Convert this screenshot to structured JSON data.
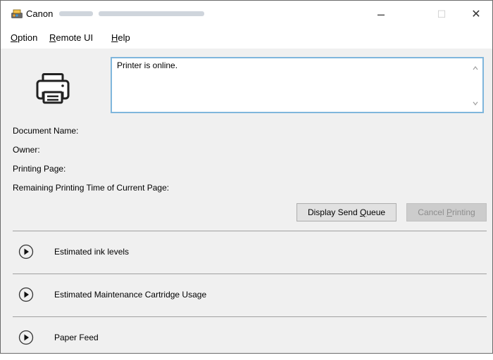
{
  "titlebar": {
    "brand": "Canon",
    "buttons": {
      "minimize": "–",
      "maximize": "☐",
      "close": "✕"
    }
  },
  "menu": [
    {
      "mnemonic": "O",
      "rest": "ption"
    },
    {
      "mnemonic": "R",
      "rest": "emote UI"
    },
    {
      "mnemonic": "H",
      "rest": "elp"
    }
  ],
  "status": {
    "message": "Printer is online."
  },
  "info": {
    "document_name": "Document Name:",
    "owner": "Owner:",
    "printing_page": "Printing Page:",
    "remaining_time": "Remaining Printing Time of Current Page:"
  },
  "buttons": {
    "display_queue": {
      "before": "Display Send ",
      "mnemonic": "Q",
      "after": "ueue"
    },
    "cancel_printing": {
      "before": "Cancel ",
      "mnemonic": "P",
      "after": "rinting"
    }
  },
  "sections": [
    {
      "label": "Estimated ink levels"
    },
    {
      "label": "Estimated Maintenance Cartridge Usage"
    },
    {
      "label": "Paper Feed"
    }
  ],
  "icons": {
    "app": "canon-app-icon",
    "printer": "printer-icon",
    "expand": "expand-arrow-icon"
  },
  "colors": {
    "status_border": "#7fb6dc",
    "disabled_text": "#8d8d8d"
  }
}
